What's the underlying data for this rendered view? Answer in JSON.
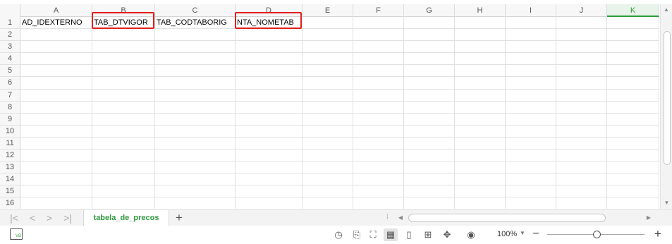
{
  "columns": [
    "A",
    "B",
    "C",
    "D",
    "E",
    "F",
    "G",
    "H",
    "I",
    "J",
    "K"
  ],
  "selected_column": "K",
  "rows": [
    {
      "num": "1",
      "cells": [
        "AD_IDEXTERNO",
        "TAB_DTVIGOR",
        "TAB_CODTABORIG",
        "NTA_NOMETAB",
        "",
        "",
        "",
        "",
        "",
        "",
        ""
      ]
    },
    {
      "num": "2",
      "cells": []
    },
    {
      "num": "3",
      "cells": []
    },
    {
      "num": "4",
      "cells": []
    },
    {
      "num": "5",
      "cells": []
    },
    {
      "num": "6",
      "cells": []
    },
    {
      "num": "7",
      "cells": []
    },
    {
      "num": "8",
      "cells": []
    },
    {
      "num": "9",
      "cells": []
    },
    {
      "num": "10",
      "cells": []
    },
    {
      "num": "11",
      "cells": []
    },
    {
      "num": "12",
      "cells": []
    },
    {
      "num": "13",
      "cells": []
    },
    {
      "num": "14",
      "cells": []
    },
    {
      "num": "15",
      "cells": []
    },
    {
      "num": "16",
      "cells": []
    }
  ],
  "highlighted_cells": [
    "B1",
    "D1"
  ],
  "sheet_tab": {
    "label": "tabela_de_precos"
  },
  "nav": {
    "first": "|<",
    "prev": "<",
    "next": ">",
    "last": ">|",
    "add": "+"
  },
  "status": {
    "zoom": "100%",
    "zoom_level_percent": 100,
    "icons": [
      "macro-icon",
      "focus-icon",
      "freeze-icon",
      "fullscreen-icon",
      "normal-view-icon",
      "page-layout-icon",
      "page-break-icon",
      "read-mode-icon",
      "eye-protection-icon"
    ]
  },
  "colors": {
    "accent": "#2f9a3d",
    "highlight": "#e0201e"
  }
}
